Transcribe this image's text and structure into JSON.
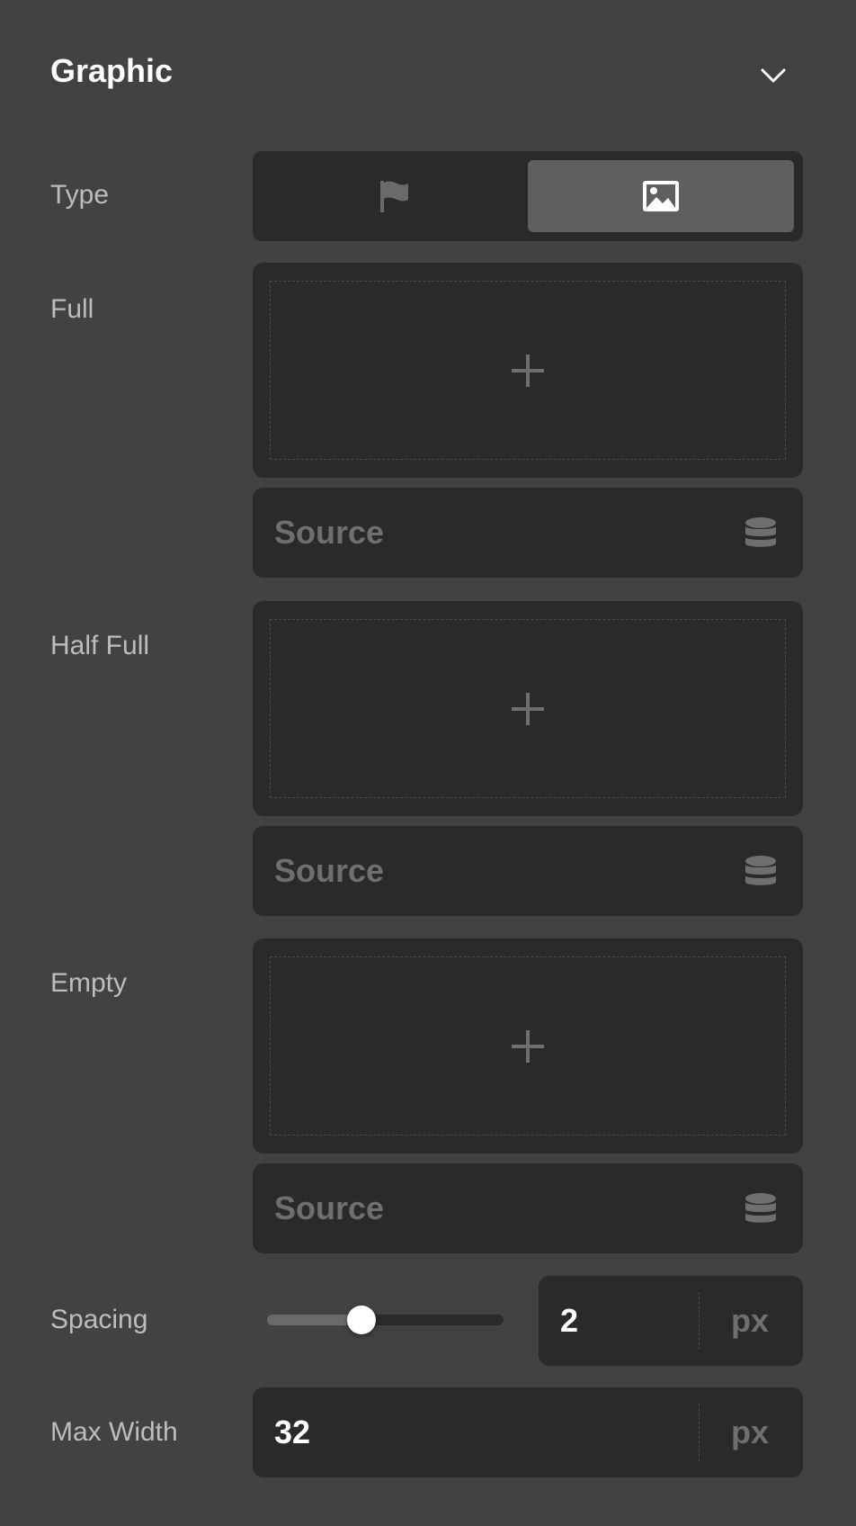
{
  "panel": {
    "title": "Graphic"
  },
  "type": {
    "label": "Type",
    "options": [
      {
        "icon": "flag-icon",
        "selected": false
      },
      {
        "icon": "image-icon",
        "selected": true
      }
    ]
  },
  "graphics": [
    {
      "label": "Full",
      "source_placeholder": "Source"
    },
    {
      "label": "Half Full",
      "source_placeholder": "Source"
    },
    {
      "label": "Empty",
      "source_placeholder": "Source"
    }
  ],
  "spacing": {
    "label": "Spacing",
    "value": "2",
    "unit": "px",
    "slider_fraction": 0.4
  },
  "max_width": {
    "label": "Max Width",
    "value": "32",
    "unit": "px"
  },
  "colors": {
    "panel_bg": "#424242",
    "field_bg": "#2a2a2a",
    "selected_option_bg": "#5f5f5f",
    "placeholder_text": "#6f6f6f",
    "value_text": "#ffffff"
  }
}
